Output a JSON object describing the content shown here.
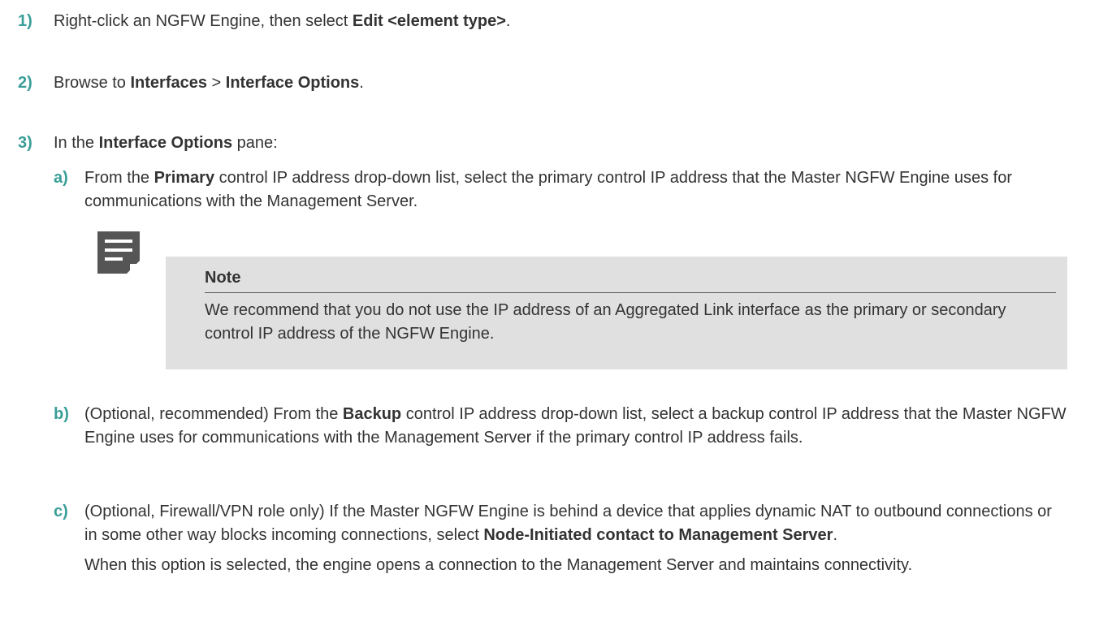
{
  "steps": [
    {
      "num": "1)",
      "parts": [
        {
          "t": "Right-click an NGFW Engine, then select "
        },
        {
          "t": "Edit <element type>",
          "b": true
        },
        {
          "t": "."
        }
      ]
    },
    {
      "num": "2)",
      "parts": [
        {
          "t": "Browse to "
        },
        {
          "t": "Interfaces",
          "b": true
        },
        {
          "t": " > "
        },
        {
          "t": "Interface Options",
          "b": true
        },
        {
          "t": "."
        }
      ]
    },
    {
      "num": "3)",
      "parts": [
        {
          "t": "In the "
        },
        {
          "t": "Interface Options",
          "b": true
        },
        {
          "t": " pane:"
        }
      ]
    }
  ],
  "substeps": [
    {
      "num": "a)",
      "parts": [
        {
          "t": "From the "
        },
        {
          "t": "Primary",
          "b": true
        },
        {
          "t": " control IP address drop-down list, select the primary control IP address that the Master NGFW Engine uses for communications with the Management Server."
        }
      ]
    },
    {
      "num": "b)",
      "parts": [
        {
          "t": "(Optional, recommended) From the "
        },
        {
          "t": "Backup",
          "b": true
        },
        {
          "t": " control IP address drop-down list, select a backup control IP address that the Master NGFW Engine uses for communications with the Management Server if the primary control IP address fails."
        }
      ]
    },
    {
      "num": "c)",
      "parts": [
        {
          "t": "(Optional, Firewall/VPN role only) If the Master NGFW Engine is behind a device that applies dynamic NAT to outbound connections or in some other way blocks incoming connections, select "
        },
        {
          "t": "Node-Initiated contact to Management Server",
          "b": true
        },
        {
          "t": "."
        }
      ]
    }
  ],
  "note": {
    "title": "Note",
    "text": "We recommend that you do not use the IP address of an Aggregated Link interface as the primary or secondary control IP address of the NGFW Engine."
  },
  "followup_text": "When this option is selected, the engine opens a connection to the Management Server and maintains connectivity.",
  "icons": {
    "note": "note-icon"
  },
  "colors": {
    "step_number": "#3a9e98",
    "note_background": "#e0e0e0",
    "note_icon": "#555555"
  }
}
